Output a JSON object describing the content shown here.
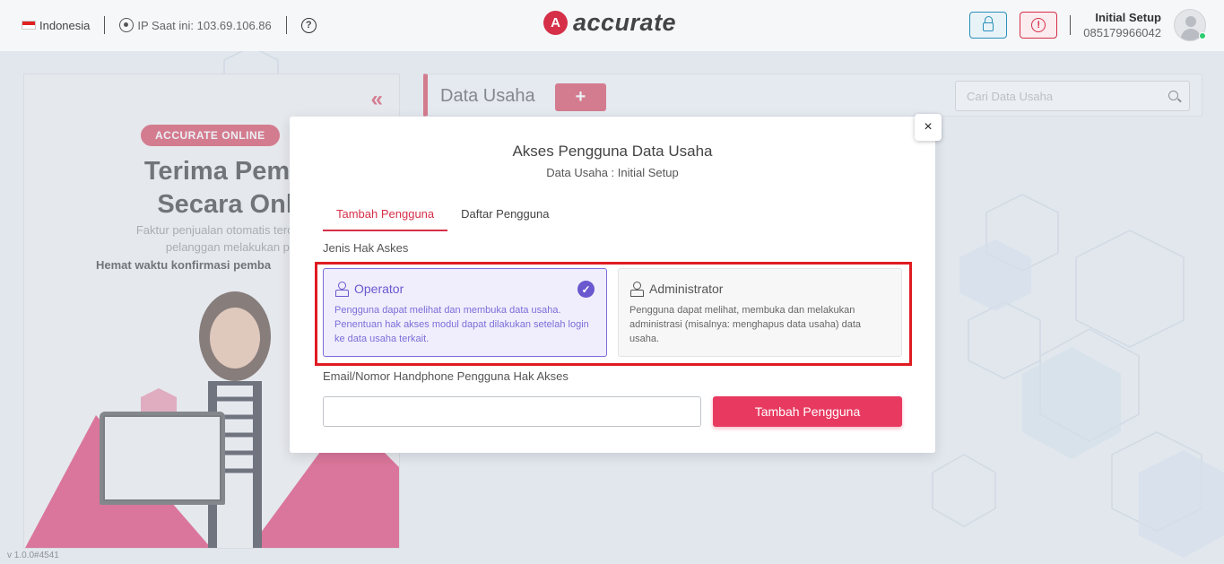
{
  "topbar": {
    "country": "Indonesia",
    "ip_text": "IP Saat ini: 103.69.106.86",
    "help_symbol": "?",
    "brand_name": "accurate",
    "brand_letter": "A",
    "user_name": "Initial Setup",
    "user_phone": "085179966042"
  },
  "promo": {
    "collapse_symbol": "«",
    "badge": "ACCURATE ONLINE",
    "title_line1": "Terima Pembay",
    "title_line2": "Secara Onlin",
    "desc_line1": "Faktur penjualan otomatis  tercatat lu",
    "desc_line2": "pelanggan melakukan pembaya",
    "strong_text": "Hemat waktu konfirmasi pemba"
  },
  "version": "v 1.0.0#4541",
  "card": {
    "title": "Data Usaha",
    "add_symbol": "+",
    "search_placeholder": "Cari Data Usaha"
  },
  "modal": {
    "close_symbol": "×",
    "title": "Akses Pengguna Data Usaha",
    "subtitle": "Data Usaha : Initial Setup",
    "tabs": [
      {
        "label": "Tambah Pengguna",
        "active": true
      },
      {
        "label": "Daftar Pengguna",
        "active": false
      }
    ],
    "access_label": "Jenis Hak Askes",
    "options": [
      {
        "title": "Operator",
        "description": "Pengguna dapat melihat dan membuka data usaha. Penentuan hak akses modul dapat dilakukan setelah login ke data usaha terkait.",
        "selected": true
      },
      {
        "title": "Administrator",
        "description": "Pengguna dapat melihat, membuka dan melakukan administrasi (misalnya: menghapus data usaha) data usaha.",
        "selected": false
      }
    ],
    "check_symbol": "✓",
    "email_label": "Email/Nomor Handphone Pengguna Hak Akses",
    "email_value": "",
    "submit_label": "Tambah Pengguna"
  },
  "colors": {
    "brand": "#d62f48",
    "selected_option": "#6a58cf",
    "highlight_box": "#e01b22",
    "submit_button": "#e83a60"
  }
}
